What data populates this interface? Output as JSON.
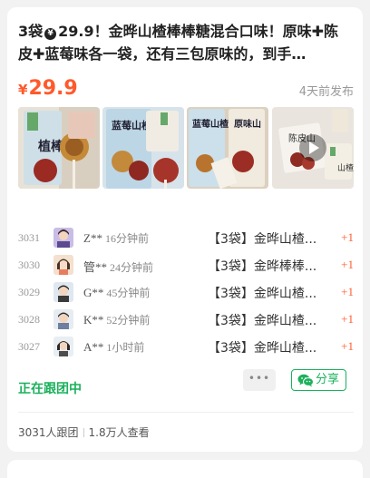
{
  "post": {
    "title_part1": "3袋",
    "title_currency_icon": "¥",
    "title_part2": "29.9！金晔山楂棒棒糖混合口味！原味✚陈皮✚蓝莓味各一袋，还有三包原味的，到手…",
    "price_symbol": "¥",
    "price_value": "29.9",
    "posted_time": "4天前发布"
  },
  "images": [
    {
      "name": "candy-photo-1",
      "icon": "image"
    },
    {
      "name": "candy-photo-2",
      "icon": "image"
    },
    {
      "name": "candy-photo-3",
      "icon": "image"
    },
    {
      "name": "candy-video-4",
      "icon": "play-icon"
    }
  ],
  "orders": [
    {
      "no": "3031",
      "user": "Z**",
      "time": "16分钟前",
      "item": "【3袋】金晔山楂...",
      "qty": "+1"
    },
    {
      "no": "3030",
      "user": "管**",
      "time": "24分钟前",
      "item": "【3袋】金晔棒棒...",
      "qty": "+1"
    },
    {
      "no": "3029",
      "user": "G**",
      "time": "45分钟前",
      "item": "【3袋】金晔山楂...",
      "qty": "+1"
    },
    {
      "no": "3028",
      "user": "K**",
      "time": "52分钟前",
      "item": "【3袋】金晔山楂...",
      "qty": "+1"
    },
    {
      "no": "3027",
      "user": "A**",
      "time": "1小时前",
      "item": "【3袋】金晔山楂...",
      "qty": "+1"
    }
  ],
  "actions": {
    "following_label": "正在跟团中",
    "more_label": "•••",
    "share_label": "分享"
  },
  "stats": {
    "participants": "3031人跟团",
    "views": "1.8万人查看"
  },
  "colors": {
    "accent_red": "#ff5a2c",
    "accent_green": "#1bb15c"
  }
}
